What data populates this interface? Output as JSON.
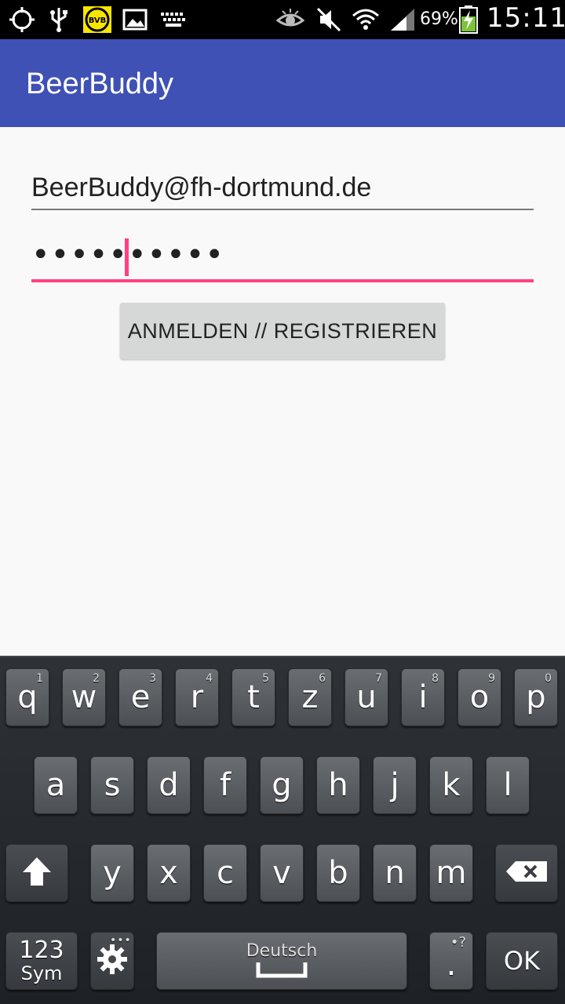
{
  "status_bar": {
    "icons": [
      "gps-icon",
      "usb-icon",
      "bvb-app-icon",
      "gallery-icon",
      "keyboard-icon",
      "eye-icon",
      "mute-icon",
      "wifi-icon",
      "signal-icon",
      "battery-charging-icon"
    ],
    "bvb_label": "BVB",
    "battery_percent": "69%",
    "time": "15:11"
  },
  "app_bar": {
    "title": "BeerBuddy",
    "color": "#3f51b5"
  },
  "form": {
    "email_value": "BeerBuddy@fh-dortmund.de",
    "password_value": "••••••••••",
    "submit_label": "ANMELDEN // REGISTRIEREN",
    "accent_color": "#ff4081"
  },
  "keyboard": {
    "row1": [
      {
        "key": "q",
        "hint": "1"
      },
      {
        "key": "w",
        "hint": "2"
      },
      {
        "key": "e",
        "hint": "3"
      },
      {
        "key": "r",
        "hint": "4"
      },
      {
        "key": "t",
        "hint": "5"
      },
      {
        "key": "z",
        "hint": "6"
      },
      {
        "key": "u",
        "hint": "7"
      },
      {
        "key": "i",
        "hint": "8"
      },
      {
        "key": "o",
        "hint": "9"
      },
      {
        "key": "p",
        "hint": "0"
      }
    ],
    "row2": [
      "a",
      "s",
      "d",
      "f",
      "g",
      "h",
      "j",
      "k",
      "l"
    ],
    "row3": [
      "y",
      "x",
      "c",
      "v",
      "b",
      "n",
      "m"
    ],
    "sym_top": "123",
    "sym_bottom": "Sym",
    "space_label": "Deutsch",
    "period_key": ".",
    "period_hint": "•?",
    "ok_label": "OK"
  }
}
